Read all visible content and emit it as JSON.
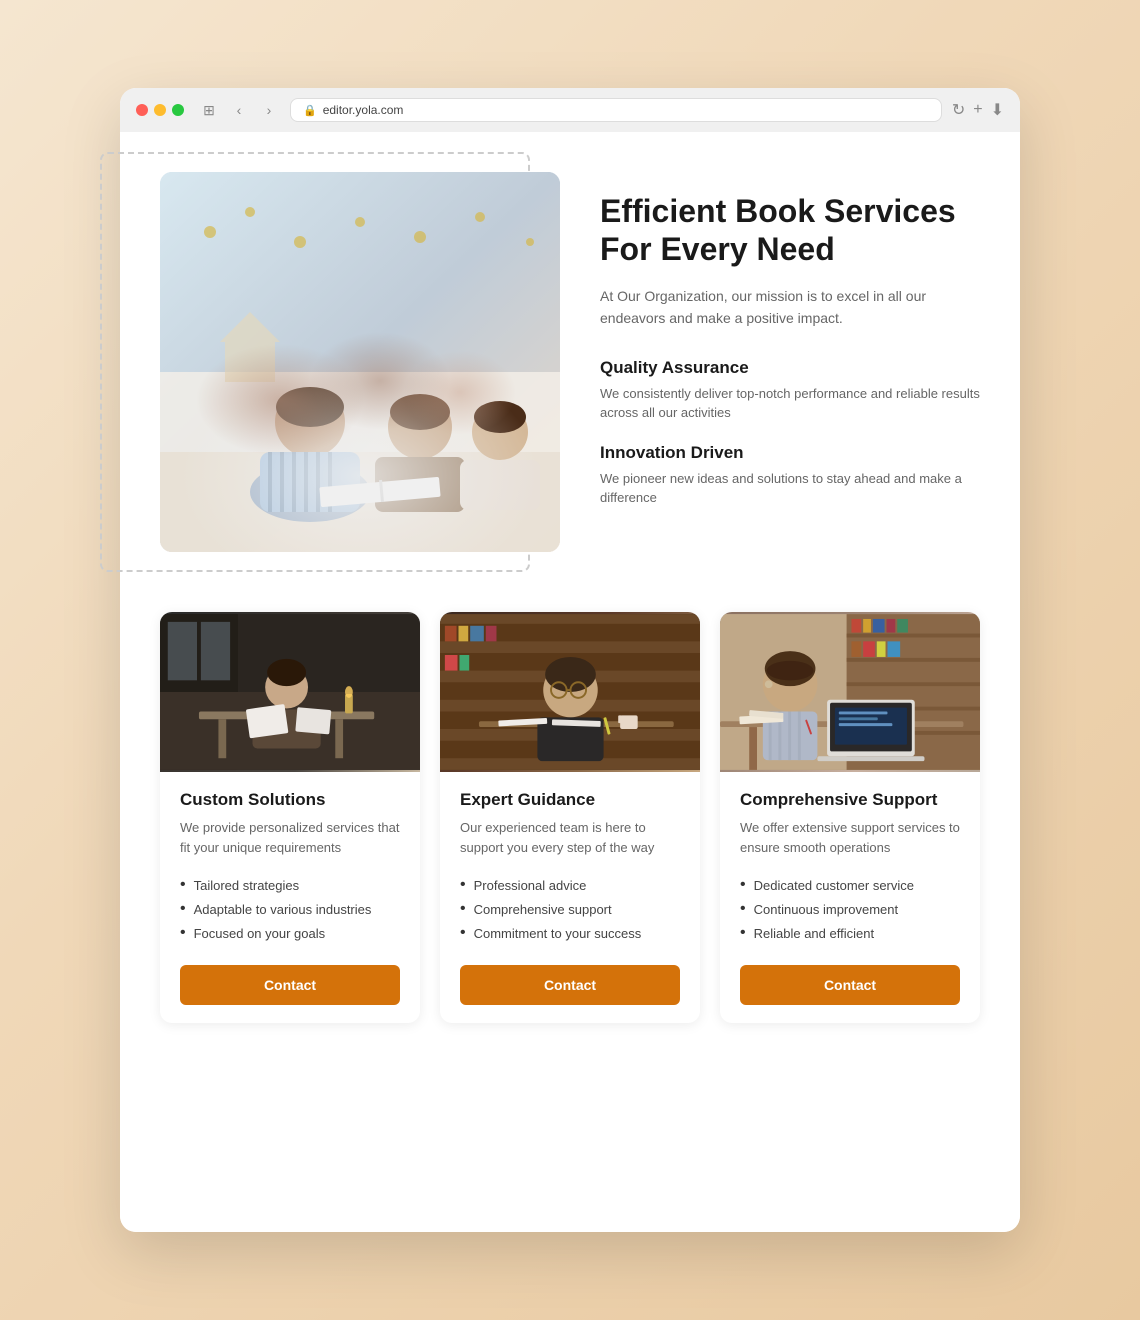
{
  "browser": {
    "url": "editor.yola.com",
    "back_label": "‹",
    "forward_label": "›",
    "tab_label": "⊞"
  },
  "hero": {
    "title": "Efficient Book Services For Every Need",
    "description": "At Our Organization, our mission is to excel in all our endeavors and make a positive impact.",
    "features": [
      {
        "title": "Quality Assurance",
        "desc": "We consistently deliver top-notch performance and reliable results across all our activities"
      },
      {
        "title": "Innovation Driven",
        "desc": "We pioneer new ideas and solutions to stay ahead and make a difference"
      }
    ]
  },
  "cards": [
    {
      "title": "Custom Solutions",
      "desc": "We provide personalized services that fit your unique requirements",
      "list": [
        "Tailored strategies",
        "Adaptable to various industries",
        "Focused on your goals"
      ],
      "button": "Contact"
    },
    {
      "title": "Expert Guidance",
      "desc": "Our experienced team is here to support you every step of the way",
      "list": [
        "Professional advice",
        "Comprehensive support",
        "Commitment to your success"
      ],
      "button": "Contact"
    },
    {
      "title": "Comprehensive Support",
      "desc": "We offer extensive support services to ensure smooth operations",
      "list": [
        "Dedicated customer service",
        "Continuous improvement",
        "Reliable and efficient"
      ],
      "button": "Contact"
    }
  ]
}
